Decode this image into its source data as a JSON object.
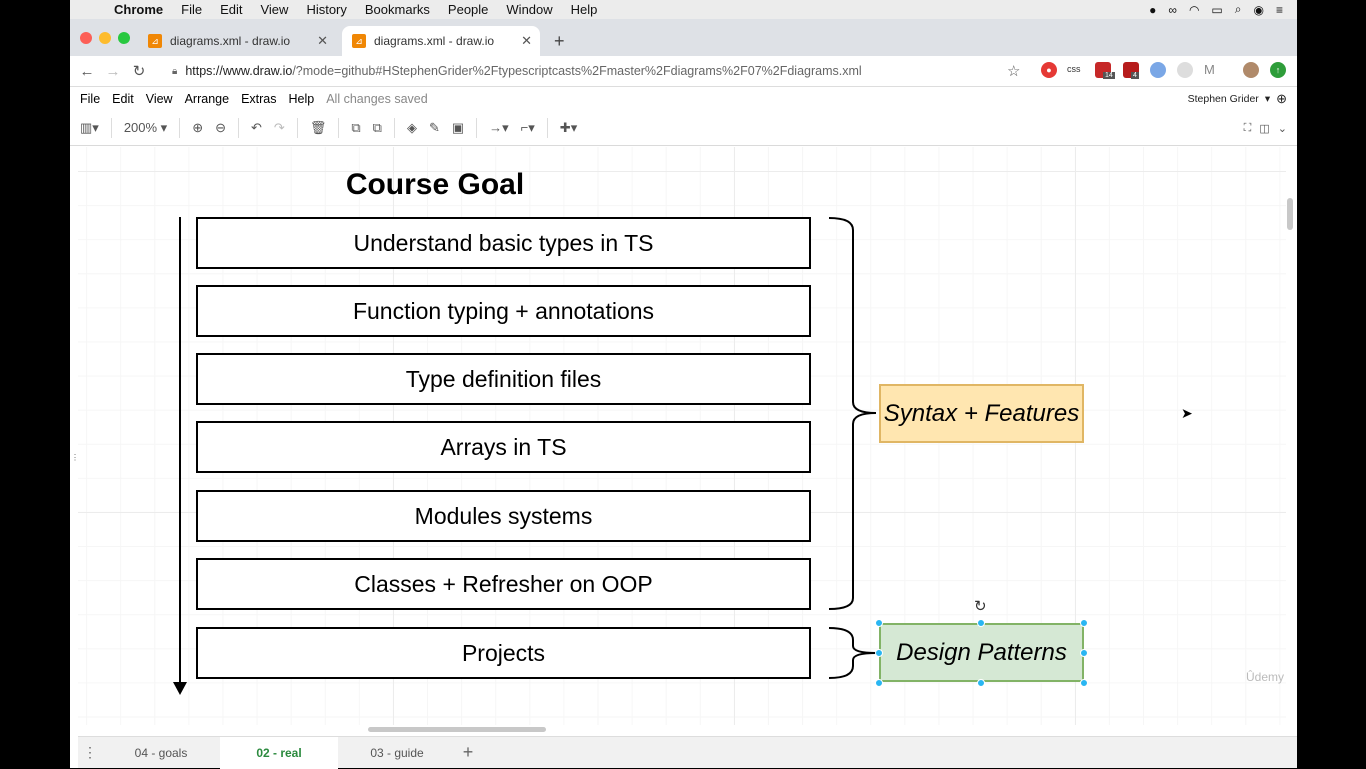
{
  "macos_menubar": {
    "app": "Chrome",
    "items": [
      "File",
      "Edit",
      "View",
      "History",
      "Bookmarks",
      "People",
      "Window",
      "Help"
    ]
  },
  "browser": {
    "tabs": [
      {
        "title": "diagrams.xml - draw.io",
        "active": false
      },
      {
        "title": "diagrams.xml - draw.io",
        "active": true
      }
    ],
    "url_host": "https://www.draw.io",
    "url_path": "/?mode=github#HStephenGrider%2Ftypescriptcasts%2Fmaster%2Fdiagrams%2F07%2Fdiagrams.xml",
    "ext_badges": [
      "css",
      "14",
      "4"
    ]
  },
  "app_menu": {
    "items": [
      "File",
      "Edit",
      "View",
      "Arrange",
      "Extras",
      "Help"
    ],
    "status": "All changes saved",
    "user": "Stephen Grider"
  },
  "toolbar": {
    "zoom": "200%"
  },
  "diagram": {
    "title": "Course Goal",
    "goals": [
      "Understand basic types in TS",
      "Function typing + annotations",
      "Type definition files",
      "Arrays in TS",
      "Modules systems",
      "Classes + Refresher on OOP",
      "Projects"
    ],
    "group_syntax": "Syntax + Features",
    "group_design": "Design Patterns",
    "colors": {
      "syntax_fill": "#ffe6b0",
      "syntax_stroke": "#e0b664",
      "design_fill": "#d5e8d4",
      "design_stroke": "#82b366",
      "selection": "#29b6f2"
    }
  },
  "watermark": "Ûdemy",
  "page_tabs": {
    "items": [
      "04 - goals",
      "02 - real",
      "03 - guide"
    ],
    "active": "02 - real"
  }
}
